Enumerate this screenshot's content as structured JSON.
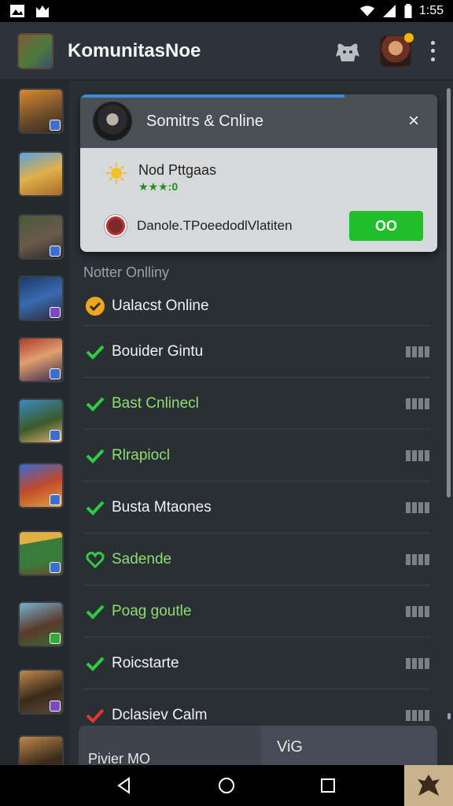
{
  "status_bar": {
    "time": "1:55"
  },
  "app_bar": {
    "title": "KomunitasNoe"
  },
  "card": {
    "title": "Somitrs & Cnline",
    "close_glyph": "×",
    "name": "Nod Pttgaas",
    "stars": "★★★:0",
    "row2_text": "Danole.TPoeedodlVlatiten",
    "go_label": "OO"
  },
  "section_label": "Notter Onlliny",
  "list": [
    {
      "label": "Ualacst Online",
      "status": "yellow-check",
      "green": false,
      "bars": false
    },
    {
      "label": "Bouider Gintu",
      "status": "check",
      "green": false,
      "bars": true
    },
    {
      "label": "Bast Cnlinecl",
      "status": "check",
      "green": true,
      "bars": true
    },
    {
      "label": "Rlrapiocl",
      "status": "check",
      "green": true,
      "bars": true
    },
    {
      "label": "Busta Mtaones",
      "status": "check",
      "green": false,
      "bars": true
    },
    {
      "label": "Sadende",
      "status": "heart",
      "green": true,
      "bars": true
    },
    {
      "label": "Poag goutle",
      "status": "check",
      "green": true,
      "bars": true
    },
    {
      "label": "Roicstarte",
      "status": "check",
      "green": false,
      "bars": true
    },
    {
      "label": "Dclasiev Calm",
      "status": "red-check",
      "green": false,
      "bars": true
    }
  ],
  "bottom": {
    "left_text": "Pivier MO",
    "right_text": "ViG"
  },
  "colors": {
    "accent_blue": "#3d8ad9",
    "green": "#1fbe2a",
    "check_green": "#2ecc40"
  }
}
